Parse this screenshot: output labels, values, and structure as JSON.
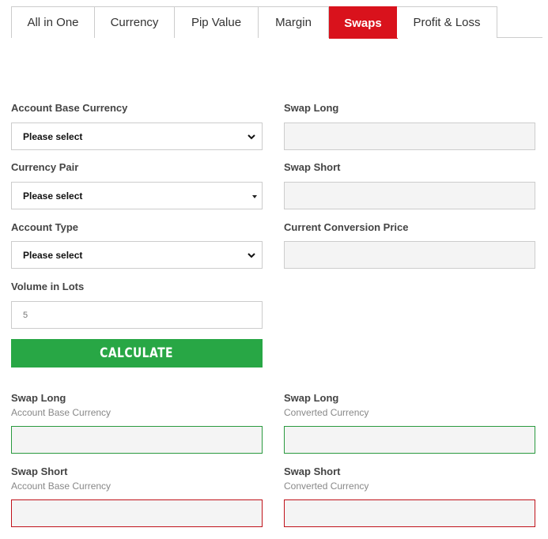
{
  "tabs": [
    {
      "label": "All in One",
      "active": false
    },
    {
      "label": "Currency",
      "active": false
    },
    {
      "label": "Pip Value",
      "active": false
    },
    {
      "label": "Margin",
      "active": false
    },
    {
      "label": "Swaps",
      "active": true
    },
    {
      "label": "Profit & Loss",
      "active": false
    }
  ],
  "form": {
    "account_base_currency": {
      "label": "Account Base Currency",
      "value": "Please select"
    },
    "currency_pair": {
      "label": "Currency Pair",
      "value": "Please select"
    },
    "account_type": {
      "label": "Account Type",
      "value": "Please select"
    },
    "volume": {
      "label": "Volume in Lots",
      "value": "5"
    },
    "swap_long": {
      "label": "Swap Long"
    },
    "swap_short": {
      "label": "Swap Short"
    },
    "conversion_price": {
      "label": "Current Conversion Price"
    }
  },
  "calculate_label": "CALCULATE",
  "results": {
    "swap_long_base": {
      "label": "Swap Long",
      "sublabel": "Account Base Currency"
    },
    "swap_long_converted": {
      "label": "Swap Long",
      "sublabel": "Converted Currency"
    },
    "swap_short_base": {
      "label": "Swap Short",
      "sublabel": "Account Base Currency"
    },
    "swap_short_converted": {
      "label": "Swap Short",
      "sublabel": "Converted Currency"
    }
  },
  "colors": {
    "active_tab": "#d9121c",
    "calculate_button": "#28a745",
    "long_result_border": "#2a9a3f",
    "short_result_border": "#c0121a"
  }
}
